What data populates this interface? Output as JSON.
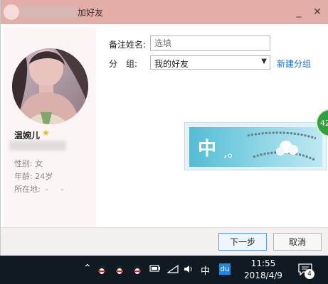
{
  "titlebar": {
    "title_suffix": "加好友",
    "minimize_glyph": "_",
    "close_glyph": "✕"
  },
  "profile": {
    "nickname": "温婉儿",
    "vip_icon": "star-icon",
    "gender": "性别: 女",
    "age": "年龄: 24岁",
    "location": "所在地:  -     -"
  },
  "form": {
    "remark_label": "备注姓名:",
    "remark_placeholder": "选填",
    "group_label": "分　组:",
    "group_value": "我的好友",
    "new_group_link": "新建分组"
  },
  "ime_toolbar": {
    "mode_char": "中",
    "punct": ",。"
  },
  "side_badge": "42",
  "buttons": {
    "next": "下一步",
    "cancel": "取消"
  },
  "taskbar": {
    "tray_icons": [
      "chevron-up-icon",
      "qq-penguin-icon",
      "qq-penguin-icon",
      "qq-penguin-icon",
      "battery-icon",
      "wifi-icon",
      "volume-icon"
    ],
    "ime_indicator": "中",
    "baidu_label": "du",
    "time": "11:55",
    "date": "2018/4/9",
    "notification_count": "4"
  },
  "colors": {
    "titlebar": "#e3aea8",
    "link": "#1e6dc0",
    "taskbar": "#101a23",
    "star": "#f3b21b",
    "ime_teal": "#54bcd4"
  }
}
